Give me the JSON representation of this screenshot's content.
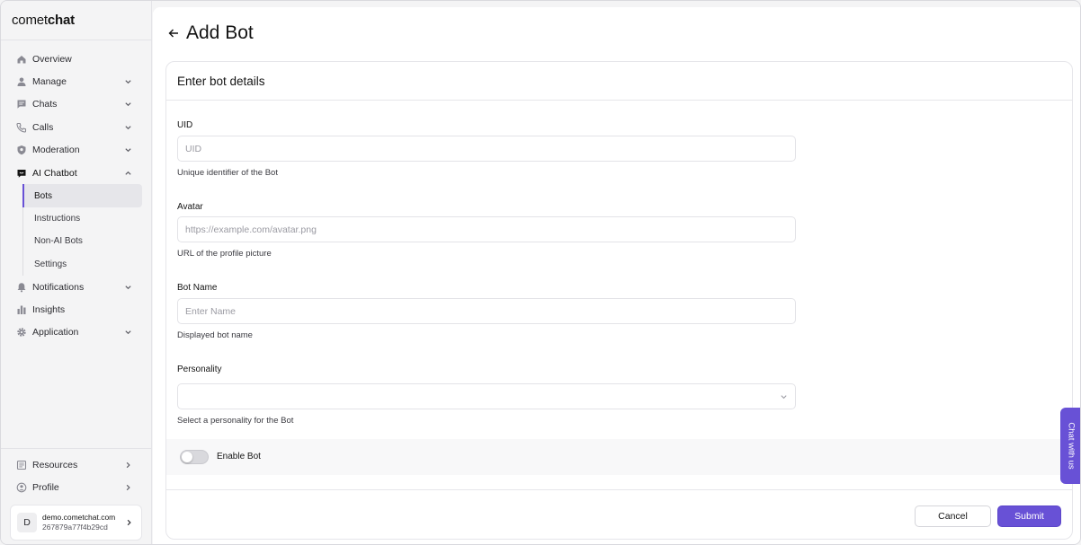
{
  "brand": {
    "light": "comet",
    "bold": "chat"
  },
  "sidebar": {
    "items": [
      {
        "label": "Overview",
        "icon": "home-icon"
      },
      {
        "label": "Manage",
        "icon": "user-icon"
      },
      {
        "label": "Chats",
        "icon": "chat-icon"
      },
      {
        "label": "Calls",
        "icon": "phone-icon"
      },
      {
        "label": "Moderation",
        "icon": "shield-icon"
      },
      {
        "label": "AI Chatbot",
        "icon": "bot-icon"
      }
    ],
    "ai_chatbot_sub": [
      "Bots",
      "Instructions",
      "Non-AI Bots",
      "Settings"
    ],
    "more_items": [
      {
        "label": "Notifications",
        "icon": "bell-icon"
      },
      {
        "label": "Insights",
        "icon": "bar-chart-icon"
      },
      {
        "label": "Application",
        "icon": "gear-icon"
      }
    ],
    "bottom_items": [
      {
        "label": "Resources",
        "icon": "book-icon"
      },
      {
        "label": "Profile",
        "icon": "profile-icon"
      }
    ],
    "account": {
      "initial": "D",
      "domain": "demo.cometchat.com",
      "id": "267879a77f4b29cd"
    }
  },
  "page": {
    "title": "Add Bot"
  },
  "form": {
    "card_title": "Enter bot details",
    "uid": {
      "label": "UID",
      "placeholder": "UID",
      "value": "",
      "help": "Unique identifier of the Bot"
    },
    "avatar": {
      "label": "Avatar",
      "placeholder": "https://example.com/avatar.png",
      "value": "",
      "help": "URL of the profile picture"
    },
    "bot_name": {
      "label": "Bot Name",
      "placeholder": "Enter Name",
      "value": "",
      "help": "Displayed bot name"
    },
    "personality": {
      "label": "Personality",
      "value": "",
      "help": "Select a personality for the Bot"
    },
    "enable_bot": {
      "label": "Enable Bot",
      "enabled": false
    },
    "cancel_label": "Cancel",
    "submit_label": "Submit"
  },
  "chat_tab": {
    "label": "Chat with us"
  },
  "colors": {
    "accent": "#6851d6",
    "background": "#f4f4f5",
    "panel": "#ffffff"
  }
}
